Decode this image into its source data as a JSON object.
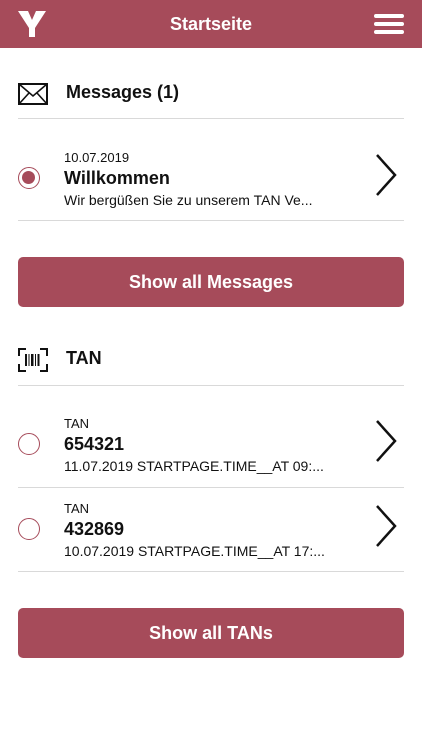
{
  "header": {
    "title": "Startseite",
    "logo_icon": "y-logo-icon",
    "menu_icon": "hamburger-menu-icon"
  },
  "colors": {
    "accent": "#a64b5a",
    "divider": "#d9d9d9",
    "text": "#111111"
  },
  "messages": {
    "title": "Messages (1)",
    "icon": "envelope-icon",
    "items": [
      {
        "date": "10.07.2019",
        "subject": "Willkommen",
        "preview": "Wir bergüßen Sie zu unserem TAN Ve...",
        "selected": true
      }
    ],
    "show_all_label": "Show all Messages"
  },
  "tan": {
    "title": "TAN",
    "icon": "barcode-scan-icon",
    "items": [
      {
        "label": "TAN",
        "code": "654321",
        "detail": "11.07.2019 STARTPAGE.TIME__AT 09:..."
      },
      {
        "label": "TAN",
        "code": "432869",
        "detail": "10.07.2019 STARTPAGE.TIME__AT 17:..."
      }
    ],
    "show_all_label": "Show all TANs"
  }
}
